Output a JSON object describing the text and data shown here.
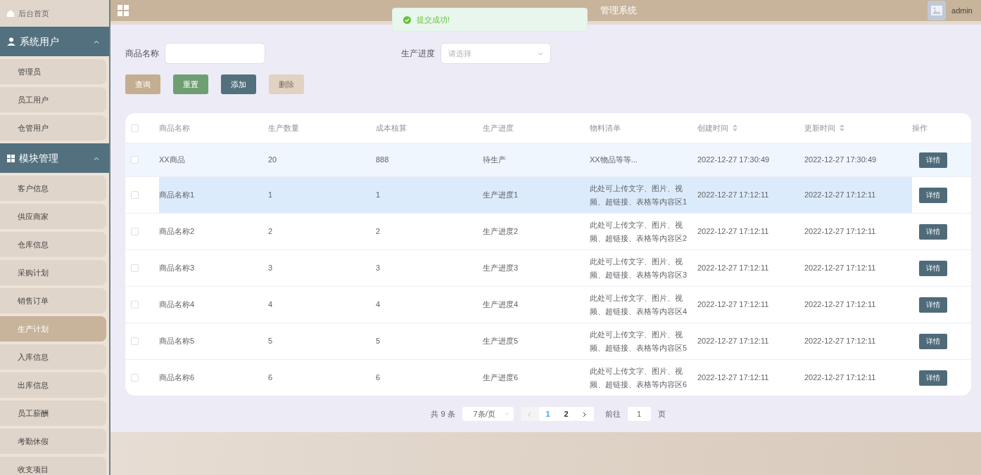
{
  "sidebar": {
    "home": {
      "label": "后台首页"
    },
    "groups": [
      {
        "label": "系统用户",
        "expanded": true,
        "items": [
          {
            "label": "管理员",
            "selected": false
          },
          {
            "label": "员工用户",
            "selected": false
          },
          {
            "label": "仓管用户",
            "selected": false
          }
        ]
      },
      {
        "label": "模块管理",
        "expanded": true,
        "items": [
          {
            "label": "客户信息",
            "selected": false
          },
          {
            "label": "供应商家",
            "selected": false
          },
          {
            "label": "仓库信息",
            "selected": false
          },
          {
            "label": "采购计划",
            "selected": false
          },
          {
            "label": "销售订单",
            "selected": false
          },
          {
            "label": "生产计划",
            "selected": true
          },
          {
            "label": "入库信息",
            "selected": false
          },
          {
            "label": "出库信息",
            "selected": false
          },
          {
            "label": "员工薪酬",
            "selected": false
          },
          {
            "label": "考勤休假",
            "selected": false
          },
          {
            "label": "收支项目",
            "selected": false
          }
        ]
      }
    ]
  },
  "header": {
    "title": "管理系统",
    "user": "admin"
  },
  "toast": {
    "message": "提交成功!"
  },
  "filters": [
    {
      "label": "商品名称",
      "kind": "text"
    },
    {
      "label": "生产进度",
      "kind": "select",
      "placeholder": "请选择"
    }
  ],
  "buttons": [
    {
      "label": "查询",
      "kind": "search",
      "disabled": false
    },
    {
      "label": "重置",
      "kind": "reset",
      "disabled": false
    },
    {
      "label": "添加",
      "kind": "add",
      "disabled": false
    },
    {
      "label": "删除",
      "kind": "delete",
      "disabled": true
    }
  ],
  "table": {
    "select_all_checked": false,
    "columns": [
      {
        "label": "商品名称",
        "sortable": false
      },
      {
        "label": "生产数量",
        "sortable": false
      },
      {
        "label": "成本核算",
        "sortable": false
      },
      {
        "label": "生产进度",
        "sortable": false
      },
      {
        "label": "物料清单",
        "sortable": false
      },
      {
        "label": "创建时间",
        "sortable": true
      },
      {
        "label": "更新时间",
        "sortable": true
      },
      {
        "label": "操作",
        "sortable": false
      }
    ],
    "rows": [
      {
        "cells": [
          "XX商品",
          "20",
          "888",
          "待生产",
          "XX物品等等...",
          "2022-12-27 17:30:49",
          "2022-12-27 17:30:49"
        ],
        "action": "详情",
        "checked": false,
        "current": true,
        "hovered": false
      },
      {
        "cells": [
          "商品名称1",
          "1",
          "1",
          "生产进度1",
          "此处可上传文字、图片、视频、超链接、表格等内容区1",
          "2022-12-27 17:12:11",
          "2022-12-27 17:12:11"
        ],
        "action": "详情",
        "checked": false,
        "current": false,
        "hovered": true
      },
      {
        "cells": [
          "商品名称2",
          "2",
          "2",
          "生产进度2",
          "此处可上传文字、图片、视频、超链接、表格等内容区2",
          "2022-12-27 17:12:11",
          "2022-12-27 17:12:11"
        ],
        "action": "详情",
        "checked": false,
        "current": false,
        "hovered": false
      },
      {
        "cells": [
          "商品名称3",
          "3",
          "3",
          "生产进度3",
          "此处可上传文字、图片、视频、超链接、表格等内容区3",
          "2022-12-27 17:12:11",
          "2022-12-27 17:12:11"
        ],
        "action": "详情",
        "checked": false,
        "current": false,
        "hovered": false
      },
      {
        "cells": [
          "商品名称4",
          "4",
          "4",
          "生产进度4",
          "此处可上传文字、图片、视频、超链接、表格等内容区4",
          "2022-12-27 17:12:11",
          "2022-12-27 17:12:11"
        ],
        "action": "详情",
        "checked": false,
        "current": false,
        "hovered": false
      },
      {
        "cells": [
          "商品名称5",
          "5",
          "5",
          "生产进度5",
          "此处可上传文字、图片、视频、超链接、表格等内容区5",
          "2022-12-27 17:12:11",
          "2022-12-27 17:12:11"
        ],
        "action": "详情",
        "checked": false,
        "current": false,
        "hovered": false
      },
      {
        "cells": [
          "商品名称6",
          "6",
          "6",
          "生产进度6",
          "此处可上传文字、图片、视频、超链接、表格等内容区6",
          "2022-12-27 17:12:11",
          "2022-12-27 17:12:11"
        ],
        "action": "详情",
        "checked": false,
        "current": false,
        "hovered": false
      }
    ]
  },
  "pagination": {
    "total": "共 9 条",
    "page_size": "7条/页",
    "pages": [
      {
        "label": "1",
        "selected": true
      },
      {
        "label": "2",
        "selected": false
      }
    ],
    "prev_disabled": true,
    "goto_label": "前往",
    "goto_value": "1",
    "goto_suffix": "页"
  }
}
